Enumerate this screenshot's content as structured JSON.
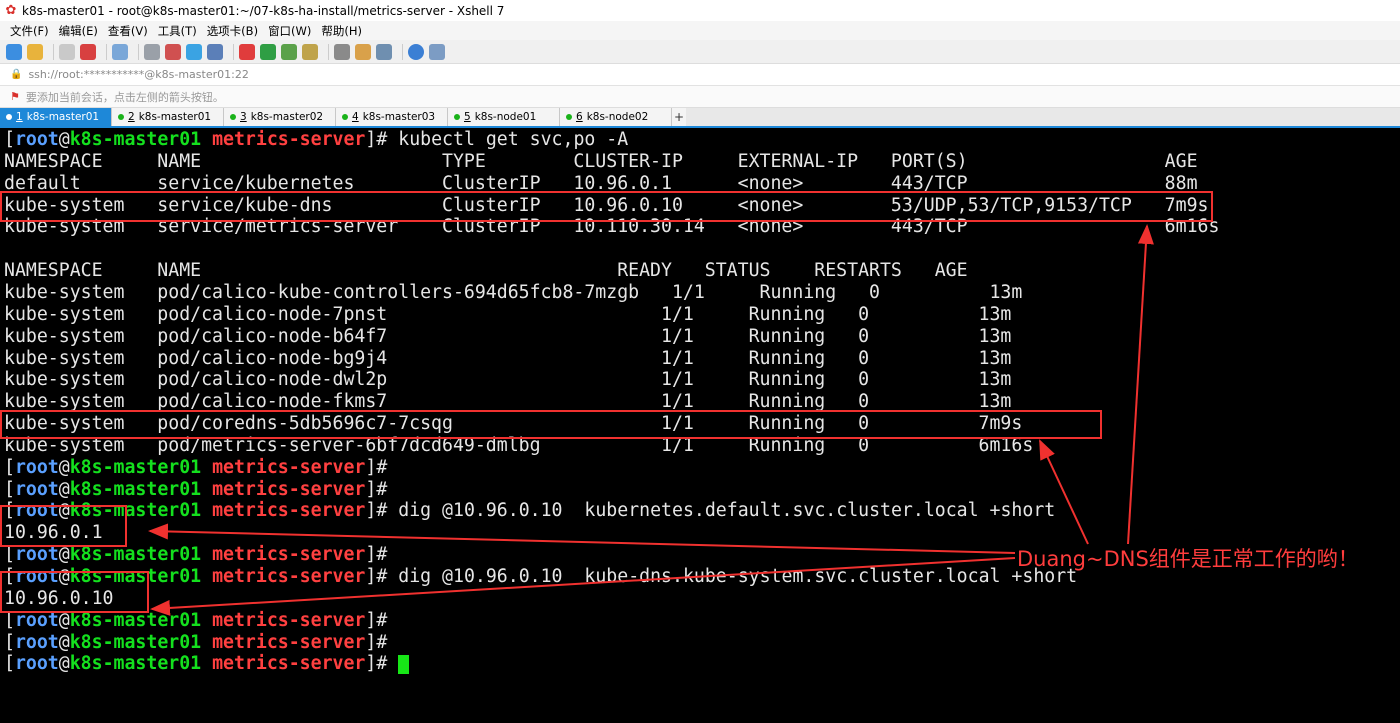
{
  "window": {
    "title": "k8s-master01 - root@k8s-master01:~/07-k8s-ha-install/metrics-server - Xshell 7"
  },
  "menu": [
    "文件(F)",
    "编辑(E)",
    "查看(V)",
    "工具(T)",
    "选项卡(B)",
    "窗口(W)",
    "帮助(H)"
  ],
  "address": "ssh://root:***********@k8s-master01:22",
  "hint": "要添加当前会话，点击左侧的箭头按钮。",
  "tabs": [
    {
      "num": "1",
      "label": "k8s-master01",
      "active": true
    },
    {
      "num": "2",
      "label": "k8s-master01",
      "active": false
    },
    {
      "num": "3",
      "label": "k8s-master02",
      "active": false
    },
    {
      "num": "4",
      "label": "k8s-master03",
      "active": false
    },
    {
      "num": "5",
      "label": "k8s-node01",
      "active": false
    },
    {
      "num": "6",
      "label": "k8s-node02",
      "active": false
    }
  ],
  "prompt": {
    "open": "[",
    "user": "root",
    "at": "@",
    "host": "k8s-master01",
    "dir": "metrics-server",
    "close": "]#"
  },
  "lines": [
    {
      "type": "prompt",
      "cmd": " kubectl get svc,po -A"
    },
    {
      "type": "out",
      "text": "NAMESPACE     NAME                      TYPE        CLUSTER-IP     EXTERNAL-IP   PORT(S)                  AGE"
    },
    {
      "type": "out",
      "text": "default       service/kubernetes        ClusterIP   10.96.0.1      <none>        443/TCP                  88m"
    },
    {
      "type": "out",
      "text": "kube-system   service/kube-dns          ClusterIP   10.96.0.10     <none>        53/UDP,53/TCP,9153/TCP   7m9s"
    },
    {
      "type": "out",
      "text": "kube-system   service/metrics-server    ClusterIP   10.110.30.14   <none>        443/TCP                  6m16s"
    },
    {
      "type": "out",
      "text": ""
    },
    {
      "type": "out",
      "text": "NAMESPACE     NAME                                      READY   STATUS    RESTARTS   AGE"
    },
    {
      "type": "out",
      "text": "kube-system   pod/calico-kube-controllers-694d65fcb8-7mzgb   1/1     Running   0          13m"
    },
    {
      "type": "out",
      "text": "kube-system   pod/calico-node-7pnst                         1/1     Running   0          13m"
    },
    {
      "type": "out",
      "text": "kube-system   pod/calico-node-b64f7                         1/1     Running   0          13m"
    },
    {
      "type": "out",
      "text": "kube-system   pod/calico-node-bg9j4                         1/1     Running   0          13m"
    },
    {
      "type": "out",
      "text": "kube-system   pod/calico-node-dwl2p                         1/1     Running   0          13m"
    },
    {
      "type": "out",
      "text": "kube-system   pod/calico-node-fkms7                         1/1     Running   0          13m"
    },
    {
      "type": "out",
      "text": "kube-system   pod/coredns-5db5696c7-7csqg                   1/1     Running   0          7m9s"
    },
    {
      "type": "out",
      "text": "kube-system   pod/metrics-server-6bf7dcd649-dmlbg           1/1     Running   0          6m16s"
    },
    {
      "type": "prompt",
      "cmd": ""
    },
    {
      "type": "prompt",
      "cmd": ""
    },
    {
      "type": "prompt",
      "cmd": " dig @10.96.0.10  kubernetes.default.svc.cluster.local +short"
    },
    {
      "type": "out",
      "text": "10.96.0.1"
    },
    {
      "type": "prompt",
      "cmd": ""
    },
    {
      "type": "prompt",
      "cmd": " dig @10.96.0.10  kube-dns.kube-system.svc.cluster.local +short"
    },
    {
      "type": "out",
      "text": "10.96.0.10"
    },
    {
      "type": "prompt",
      "cmd": ""
    },
    {
      "type": "prompt",
      "cmd": ""
    },
    {
      "type": "prompt",
      "cmd": " ",
      "cursor": true
    }
  ],
  "annotation": "Duang~DNS组件是正常工作的哟！",
  "colors": {
    "highlight_box": "#f0312f",
    "prompt_user": "#5aa0ff",
    "prompt_host": "#14e01e",
    "prompt_dir": "#ff4040",
    "cursor": "#17e617",
    "tab_active": "#1e88d8"
  }
}
